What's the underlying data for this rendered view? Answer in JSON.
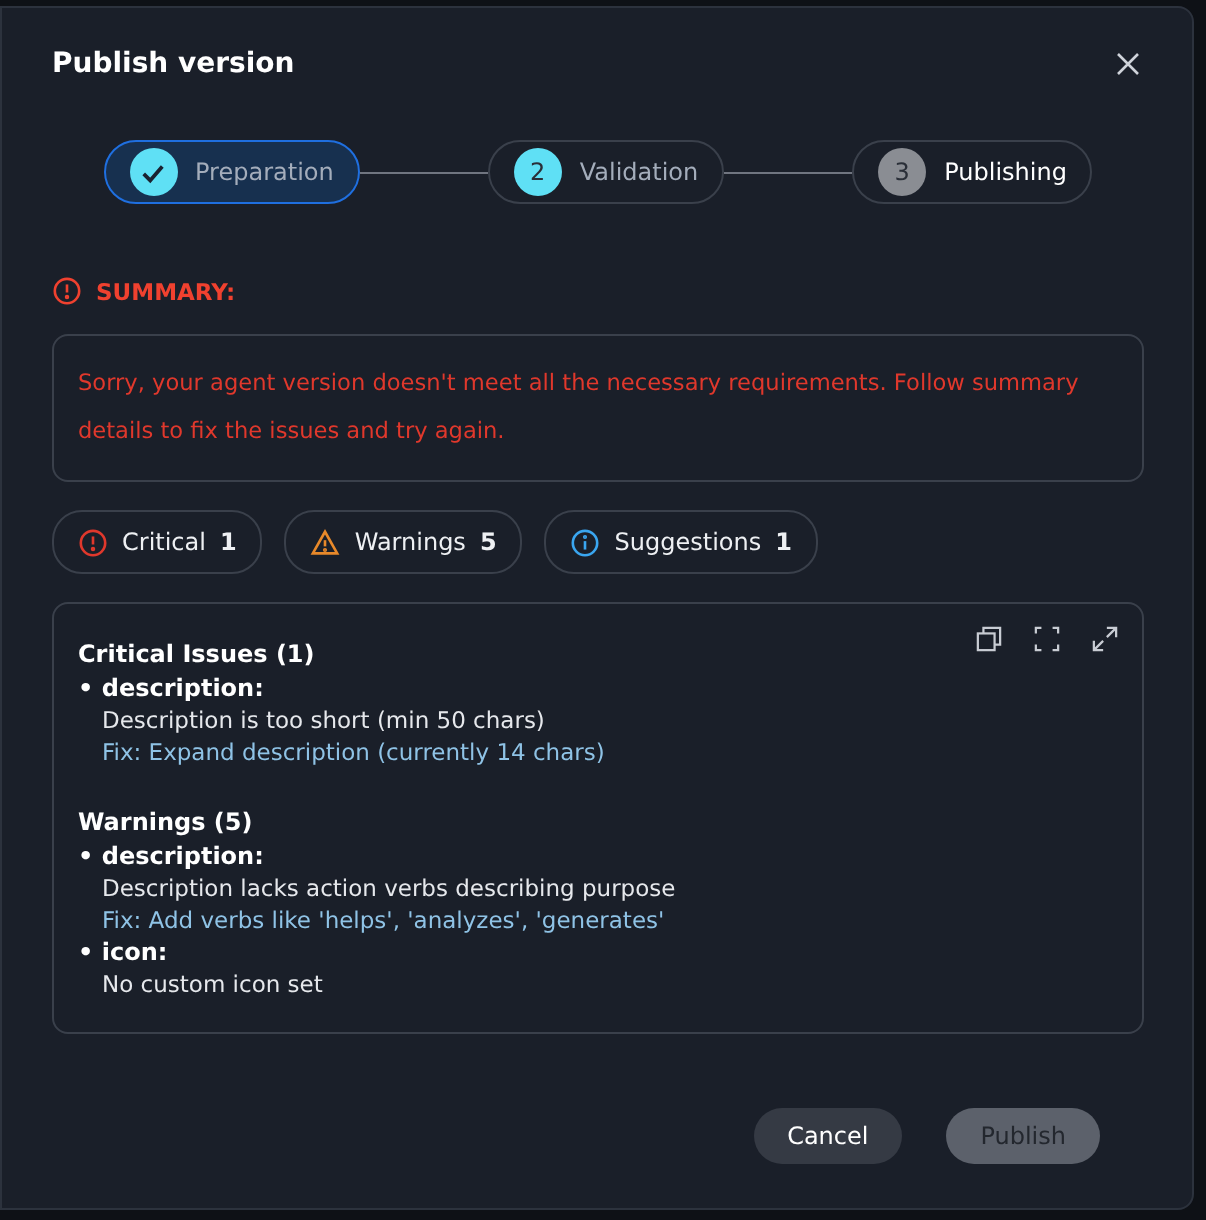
{
  "dialog": {
    "title": "Publish version"
  },
  "steps": [
    {
      "kind": "done",
      "label": "Preparation"
    },
    {
      "kind": "current",
      "marker": "2",
      "label": "Validation"
    },
    {
      "kind": "pending",
      "marker": "3",
      "label": "Publishing"
    }
  ],
  "summary": {
    "title": "SUMMARY:",
    "message": "Sorry, your agent version doesn't meet all the necessary requirements. Follow summary details to fix the issues and try again."
  },
  "counters": [
    {
      "kind": "critical",
      "label": "Critical",
      "count": "1"
    },
    {
      "kind": "warning",
      "label": "Warnings",
      "count": "5"
    },
    {
      "kind": "info",
      "label": "Suggestions",
      "count": "1"
    }
  ],
  "report": {
    "sections": [
      {
        "title": "Critical Issues (1)",
        "items": [
          {
            "field": "• description:",
            "message": "Description is too short (min 50 chars)",
            "fix": "Fix: Expand description (currently 14 chars)"
          }
        ]
      },
      {
        "title": "Warnings (5)",
        "items": [
          {
            "field": "• description:",
            "message": "Description lacks action verbs describing purpose",
            "fix": "Fix: Add verbs like 'helps', 'analyzes', 'generates'"
          },
          {
            "field": "• icon:",
            "message": "No custom icon set"
          }
        ]
      }
    ]
  },
  "buttons": [
    {
      "label": "Cancel",
      "disabled": false
    },
    {
      "label": "Publish",
      "disabled": true
    }
  ]
}
